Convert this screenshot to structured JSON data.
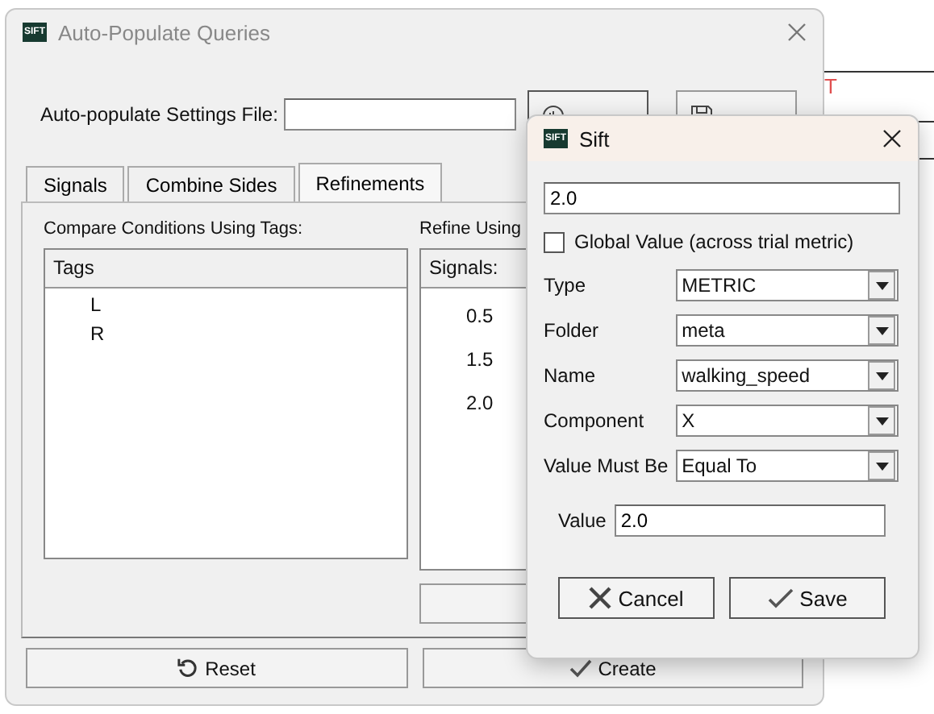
{
  "background_text": "T",
  "main_window": {
    "logo": "SIFT",
    "title": "Auto-Populate Queries",
    "settings_label": "Auto-populate Settings File:",
    "top_buttons": [
      {
        "kind": "browse"
      },
      {
        "kind": "save"
      }
    ],
    "tabs": [
      {
        "label": "Signals",
        "selected": false
      },
      {
        "label": "Combine Sides",
        "selected": false
      },
      {
        "label": "Refinements",
        "selected": true
      }
    ],
    "left_panel": {
      "label": "Compare Conditions Using Tags:",
      "header": "Tags",
      "items": [
        "L",
        "R"
      ]
    },
    "right_panel": {
      "label": "Refine Using",
      "header": "Signals:",
      "items": [
        "0.5",
        "1.5",
        "2.0"
      ]
    },
    "footer_buttons": [
      {
        "label": "Reset",
        "kind": "reset"
      },
      {
        "label": "Create",
        "kind": "check"
      }
    ]
  },
  "dialog": {
    "logo": "SIFT",
    "title": "Sift",
    "query_value": "2.0",
    "global_checkbox": {
      "label": "Global Value (across trial metric)",
      "checked": false
    },
    "fields": [
      {
        "label": "Type",
        "value": "METRIC"
      },
      {
        "label": "Folder",
        "value": "meta"
      },
      {
        "label": "Name",
        "value": "walking_speed"
      },
      {
        "label": "Component",
        "value": "X"
      },
      {
        "label": "Value Must Be",
        "value": "Equal To"
      }
    ],
    "value_label": "Value",
    "value": "2.0",
    "buttons": [
      {
        "label": "Cancel",
        "kind": "cancel"
      },
      {
        "label": "Save",
        "kind": "check"
      }
    ]
  }
}
